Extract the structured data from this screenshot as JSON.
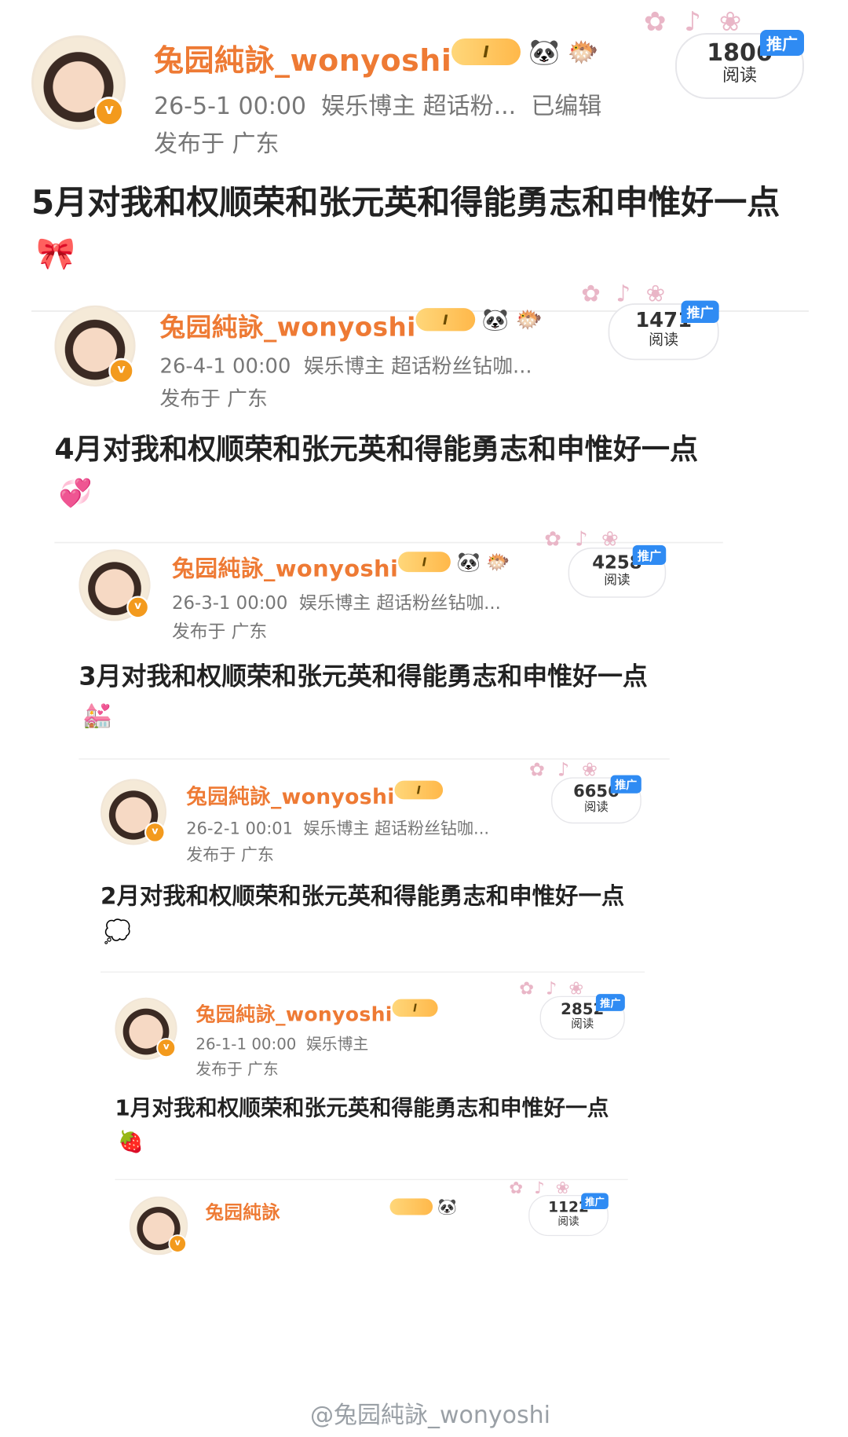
{
  "posts": [
    {
      "username": "兔园純詠_wonyoshi",
      "level": "I",
      "icons": [
        "panda-icon",
        "fish-icon"
      ],
      "timestamp": "26-5-1 00:00",
      "tags": "娱乐博主 超话粉...",
      "edited": "已编辑",
      "location": "发布于 广东",
      "reads": "1806",
      "reads_label": "阅读",
      "promo": "推广",
      "content": "5月对我和权顺荣和张元英和得能勇志和申惟好一点",
      "emoji": "🎀"
    },
    {
      "username": "兔园純詠_wonyoshi",
      "level": "I",
      "icons": [
        "panda-icon",
        "fish-icon"
      ],
      "timestamp": "26-4-1 00:00",
      "tags": "娱乐博主 超话粉丝钻咖...",
      "edited": "",
      "location": "发布于 广东",
      "reads": "1471",
      "reads_label": "阅读",
      "promo": "推广",
      "content": "4月对我和权顺荣和张元英和得能勇志和申惟好一点",
      "emoji": "💞"
    },
    {
      "username": "兔园純詠_wonyoshi",
      "level": "I",
      "icons": [
        "panda-icon",
        "fish-icon"
      ],
      "timestamp": "26-3-1 00:00",
      "tags": "娱乐博主 超话粉丝钻咖...",
      "edited": "",
      "location": "发布于 广东",
      "reads": "4258",
      "reads_label": "阅读",
      "promo": "推广",
      "content": "3月对我和权顺荣和张元英和得能勇志和申惟好一点",
      "emoji": "💒"
    },
    {
      "username": "兔园純詠_wonyoshi",
      "level": "I",
      "icons": [],
      "timestamp": "26-2-1 00:01",
      "tags": "娱乐博主 超话粉丝钻咖...",
      "edited": "",
      "location": "发布于 广东",
      "reads": "6656",
      "reads_label": "阅读",
      "promo": "推广",
      "content": "2月对我和权顺荣和张元英和得能勇志和申惟好一点",
      "emoji": "💭"
    },
    {
      "username": "兔园純詠_wonyoshi",
      "level": "I",
      "icons": [],
      "timestamp": "26-1-1 00:00",
      "tags": "娱乐博主",
      "edited": "",
      "location": "发布于 广东",
      "reads": "2852",
      "reads_label": "阅读",
      "promo": "推广",
      "content": "1月对我和权顺荣和张元英和得能勇志和申惟好一点",
      "emoji": "🍓"
    },
    {
      "username": "兔园純詠",
      "level": "",
      "icons": [
        "panda-icon"
      ],
      "timestamp": "",
      "tags": "",
      "edited": "",
      "location": "",
      "reads": "1122",
      "reads_label": "阅读",
      "promo": "推广",
      "content": "",
      "emoji": ""
    }
  ],
  "watermark": "@兔园純詠_wonyoshi"
}
